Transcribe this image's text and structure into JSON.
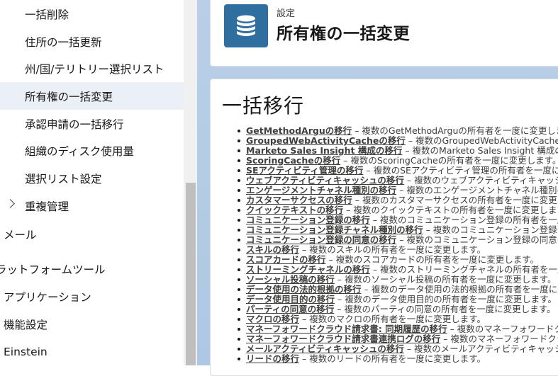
{
  "sidebar": {
    "items": [
      {
        "label": "一括削除",
        "level": "sub",
        "selected": false
      },
      {
        "label": "住所の一括更新",
        "level": "sub",
        "selected": false
      },
      {
        "label": "州/国/テリトリー選択リスト",
        "level": "sub",
        "selected": false
      },
      {
        "label": "所有権の一括変更",
        "level": "sub",
        "selected": true
      },
      {
        "label": "承認申請の一括移行",
        "level": "sub",
        "selected": false
      },
      {
        "label": "組織のディスク使用量",
        "level": "sub",
        "selected": false
      },
      {
        "label": "選択リスト設定",
        "level": "sub",
        "selected": false
      },
      {
        "label": "重複管理",
        "level": "sub",
        "selected": false,
        "collapsed": true
      },
      {
        "label": "メール",
        "level": "top",
        "selected": false
      },
      {
        "label": "ラットフォームツール",
        "level": "top-clip",
        "selected": false
      },
      {
        "label": "アプリケーション",
        "level": "top",
        "selected": false
      },
      {
        "label": "機能設定",
        "level": "top",
        "selected": false
      },
      {
        "label": "Einstein",
        "level": "top",
        "selected": false
      }
    ]
  },
  "header": {
    "eyebrow": "設定",
    "title": "所有権の一括変更",
    "icon": "database-icon",
    "icon_color": "#2e6fa0"
  },
  "content": {
    "heading": "一括移行",
    "links": [
      {
        "link": "GetMethodArguの移行",
        "desc": " – 複数のGetMethodArguの所有者を一度に変更します。"
      },
      {
        "link": "GroupedWebActivityCacheの移行",
        "desc": " – 複数のGroupedWebActivityCacheの所有者を一度に変更します。"
      },
      {
        "link": "Marketo Sales Insight 構成の移行",
        "desc": " – 複数のMarketo Sales Insight 構成の所有者を一度に変更します。"
      },
      {
        "link": "ScoringCacheの移行",
        "desc": " – 複数のScoringCacheの所有者を一度に変更します。"
      },
      {
        "link": "SEアクティビティ管理の移行",
        "desc": " – 複数のSEアクティビティ管理の所有者を一度に変更します。"
      },
      {
        "link": "ウェブアクティビティキャッシュの移行",
        "desc": " – 複数のウェブアクティビティキャッシュの所有者を一度に変更します。"
      },
      {
        "link": "エンゲージメントチャネル種別の移行",
        "desc": " – 複数のエンゲージメントチャネル種別の所有者を一度に変更します。"
      },
      {
        "link": "カスタマーサクセスの移行",
        "desc": " – 複数のカスタマーサクセスの所有者を一度に変更します。"
      },
      {
        "link": "クイックテキストの移行",
        "desc": " – 複数のクイックテキストの所有者を一度に変更します。"
      },
      {
        "link": "コミュニケーション登録の移行",
        "desc": " – 複数のコミュニケーション登録の所有者を一度に変更します。"
      },
      {
        "link": "コミュニケーション登録チャネル種別の移行",
        "desc": " – 複数のコミュニケーション登録チャネル種別の所有者を一度に変更します。"
      },
      {
        "link": "コミュニケーション登録の同意の移行",
        "desc": " – 複数のコミュニケーション登録の同意の所有者を一度に変更します。"
      },
      {
        "link": "スキルの移行",
        "desc": " – 複数のスキルの所有者を一度に変更します。"
      },
      {
        "link": "スコアカードの移行",
        "desc": " – 複数のスコアカードの所有者を一度に変更します。"
      },
      {
        "link": "ストリーミングチャネルの移行",
        "desc": " – 複数のストリーミングチャネルの所有者を一度に変更します。"
      },
      {
        "link": "ソーシャル投稿の移行",
        "desc": " – 複数のソーシャル投稿の所有者を一度に変更します。"
      },
      {
        "link": "データ使用の法的根拠の移行",
        "desc": " – 複数のデータ使用の法的根拠の所有者を一度に変更します。"
      },
      {
        "link": "データ使用目的の移行",
        "desc": " – 複数のデータ使用目的の所有者を一度に変更します。"
      },
      {
        "link": "パーティの同意の移行",
        "desc": " – 複数のパーティの同意の所有者を一度に変更します。"
      },
      {
        "link": "マクロの移行",
        "desc": " – 複数のマクロの所有者を一度に変更します。"
      },
      {
        "link": "マネーフォワードクラウド請求書: 同期履歴の移行",
        "desc": " – 複数のマネーフォワードクラウド請求書: 同期履歴の所有者を一度に変更します。"
      },
      {
        "link": "マネーフォワードクラウド請求書連携ログの移行",
        "desc": " – 複数のマネーフォワードクラウド請求書連携ログの所有者を一度に変更します。"
      },
      {
        "link": "メールアクティビティキャッシュの移行",
        "desc": " – 複数のメールアクティビティキャッシュの所有者を一度に変更します。"
      },
      {
        "link": "リードの移行",
        "desc": " – 複数のリードの所有者を一度に変更します。"
      }
    ]
  }
}
